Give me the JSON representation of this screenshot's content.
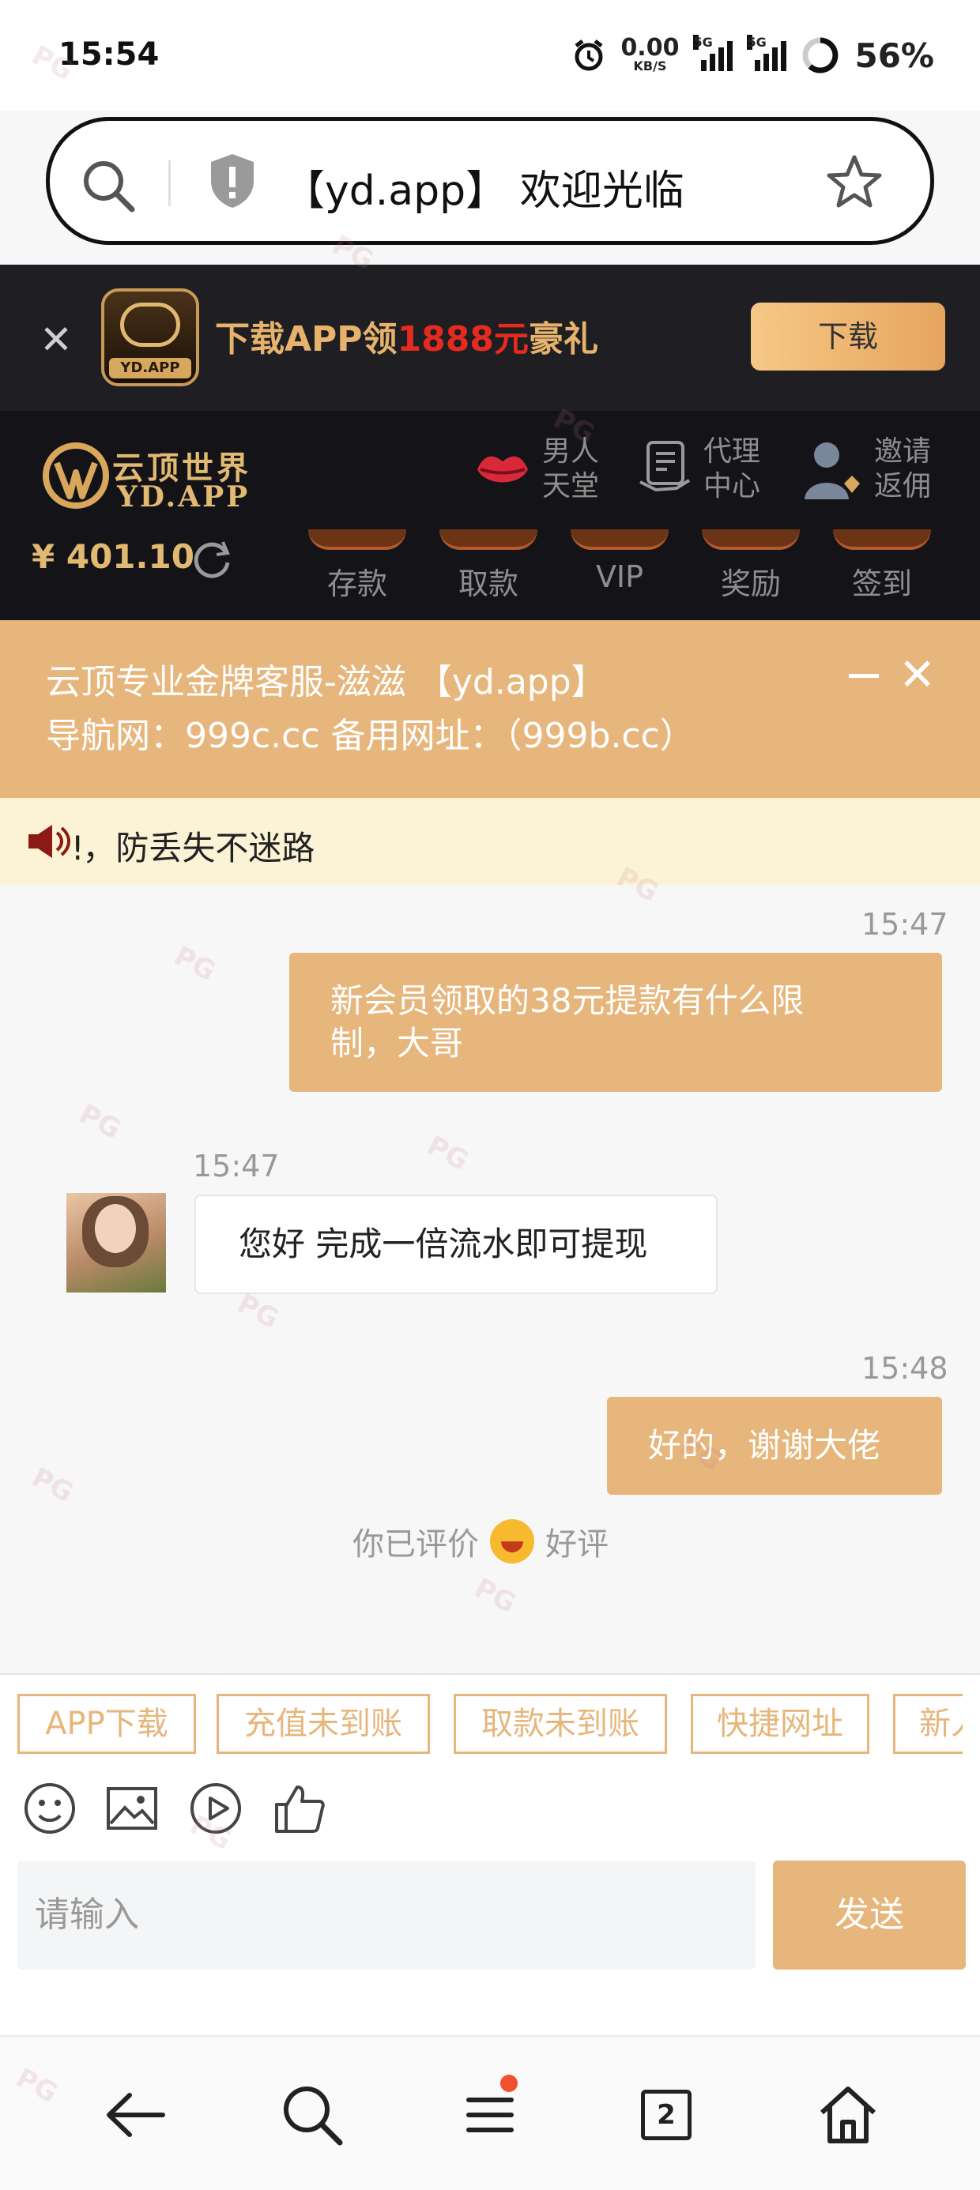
{
  "status_bar": {
    "time": "15:54",
    "net_speed": "0.00",
    "net_unit": "KB/S",
    "sim1": "5G",
    "sim2": "5G",
    "battery": "56%"
  },
  "address_bar": {
    "page_title": "【yd.app】 欢迎光临"
  },
  "download_banner": {
    "text_prefix": "下载APP领",
    "text_amount": "1888元",
    "text_suffix": "豪礼",
    "app_badge": "YD.APP",
    "button": "下载"
  },
  "header": {
    "logo_cn": "云顶世界",
    "logo_en": "YD.APP",
    "links": [
      {
        "line1": "男人",
        "line2": "天堂",
        "icon": "lips-icon"
      },
      {
        "line1": "代理",
        "line2": "中心",
        "icon": "handshake-doc-icon"
      },
      {
        "line1": "邀请",
        "line2": "返佣",
        "icon": "user-diamond-icon"
      }
    ],
    "balance": "¥ 401.10",
    "tabs": [
      "存款",
      "取款",
      "VIP",
      "奖励",
      "签到"
    ]
  },
  "notice": {
    "line1": "云顶专业金牌客服-滋滋 【yd.app】",
    "line2": "导航网：999c.cc 备用网址：（999b.cc）"
  },
  "marquee": {
    "text": "ǃ，防丢失不迷路"
  },
  "chat": {
    "messages": [
      {
        "time": "15:47",
        "line1": "新会员领取的38元提款有什么限",
        "line2": "制，大哥"
      },
      {
        "time": "15:47",
        "text": "您好 完成一倍流水即可提现"
      },
      {
        "time": "15:48",
        "text": "好的，谢谢大佬"
      }
    ],
    "rating_prefix": "你已评价",
    "rating_value": "好评"
  },
  "quick_replies": [
    "APP下载",
    "充值未到账",
    "取款未到账",
    "快捷网址",
    "新人"
  ],
  "composer": {
    "placeholder": "请输入",
    "send": "发送"
  },
  "nav": {
    "tab_count": "2"
  },
  "watermark": "PG",
  "colors": {
    "accent": "#e6b67c",
    "header_bg": "#141418",
    "gold": "#e2b971",
    "red": "#e52b1f"
  }
}
